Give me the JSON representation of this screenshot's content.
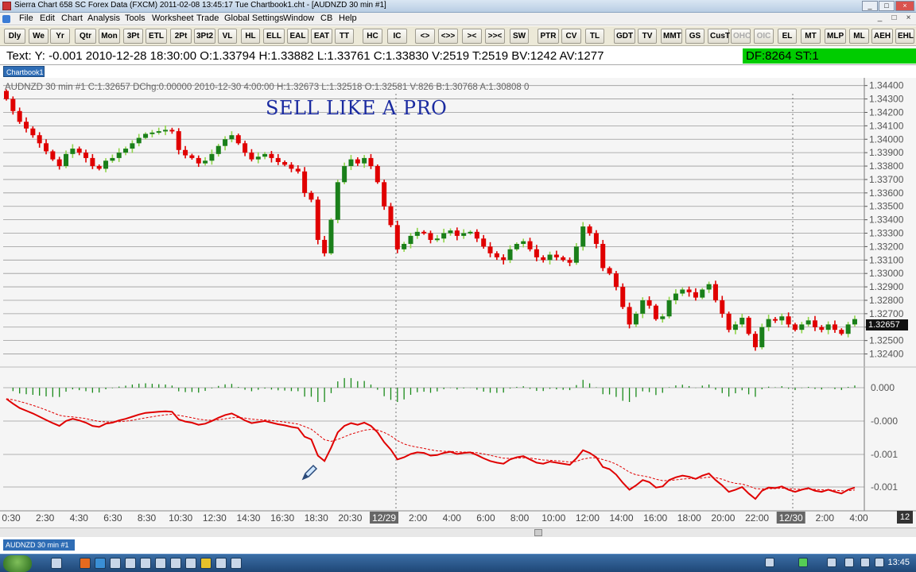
{
  "window": {
    "title": "Sierra Chart 658 SC Forex Data (FXCM) 2011-02-08  13:45:17  Tue   Chartbook1.cht - [AUDNZD  30 min   #1]",
    "controls": [
      "_",
      "□",
      "×"
    ]
  },
  "menu": {
    "items": [
      "File",
      "Edit",
      "Chart",
      "Analysis",
      "Tools",
      "Worksheet",
      "Trade",
      "Global Settings",
      "Window",
      "CB",
      "Help"
    ],
    "mdi_controls": [
      "_",
      "□",
      "×"
    ]
  },
  "toolbar": {
    "buttons": [
      "Dly",
      "We",
      "Yr",
      "Qtr",
      "Mon",
      "3Pt",
      "ETL",
      "2Pt",
      "3Pt2",
      "VL",
      "HL",
      "ELL",
      "EAL",
      "EAT",
      "TT",
      "HC",
      "IC",
      "<>",
      "<>>",
      "><",
      ">>< ",
      "SW",
      "PTR",
      "CV",
      "TL",
      "GDT",
      "TV",
      "MMT",
      "GS",
      "CusT",
      "OHC",
      "OIC",
      "EL",
      "MT",
      "MLP",
      "ML",
      "AEH",
      "EHL"
    ],
    "disabled": [
      "OHC",
      "OIC"
    ]
  },
  "status": {
    "text_line": "Text: Y: -0.001  2010-12-28   18:30:00  O:1.33794  H:1.33882  L:1.33761  C:1.33830  V:2519  T:2519  BV:1242  AV:1277",
    "df_line": "DF:8264  ST:1"
  },
  "chartbook_tab": "Chartbook1",
  "chart": {
    "header": "AUDNZD  30 min   #1 C:1.32657 DChg:0.00000 2010-12-30 4:00:00 H:1.32673 L:1.32518 O:1.32581 V:826 B:1.30768 A:1.30808 0",
    "annotation": "SELL LIKE A PRO",
    "current_price": "1.32657",
    "price_axis": [
      "1.34400",
      "1.34300",
      "1.34200",
      "1.34100",
      "1.34000",
      "1.33900",
      "1.33800",
      "1.33700",
      "1.33600",
      "1.33500",
      "1.33400",
      "1.33300",
      "1.33200",
      "1.33100",
      "1.33000",
      "1.32900",
      "1.32800",
      "1.32700",
      "1.32600",
      "1.32500",
      "1.32400"
    ],
    "indicator_axis": [
      "0.000",
      "-0.000",
      "-0.001",
      "-0.001"
    ],
    "time_labels": [
      "0:30",
      "2:30",
      "4:30",
      "6:30",
      "8:30",
      "10:30",
      "12:30",
      "14:30",
      "16:30",
      "18:30",
      "20:30",
      "12/29",
      "2:00",
      "4:00",
      "6:00",
      "8:00",
      "10:00",
      "12:00",
      "14:00",
      "16:00",
      "18:00",
      "20:00",
      "22:00",
      "12/30",
      "2:00",
      "4:00"
    ],
    "corner_label": "12",
    "colors": {
      "up": "#1a7f1a",
      "up_wick": "#8fd44a",
      "down": "#e00000",
      "macd": "#000000",
      "signal": "#e00000"
    }
  },
  "bottom_tab": "AUDNZD  30 min   #1",
  "taskbar": {
    "clock": "13:45"
  },
  "chart_data": {
    "type": "candlestick",
    "symbol": "AUDNZD",
    "interval": "30 min",
    "ylim": [
      1.3235,
      1.3441
    ],
    "closes": [
      1.343,
      1.3421,
      1.3413,
      1.3408,
      1.3403,
      1.3397,
      1.3391,
      1.3385,
      1.338,
      1.3389,
      1.3393,
      1.339,
      1.3386,
      1.338,
      1.3378,
      1.3384,
      1.3386,
      1.339,
      1.3393,
      1.3397,
      1.3401,
      1.3404,
      1.3405,
      1.3406,
      1.3407,
      1.3406,
      1.3392,
      1.3388,
      1.3386,
      1.3382,
      1.3384,
      1.3389,
      1.3395,
      1.34,
      1.3403,
      1.3397,
      1.339,
      1.3385,
      1.3387,
      1.3389,
      1.3386,
      1.3383,
      1.3381,
      1.3378,
      1.3376,
      1.336,
      1.3355,
      1.3325,
      1.3315,
      1.334,
      1.3368,
      1.338,
      1.3385,
      1.3382,
      1.3386,
      1.338,
      1.3368,
      1.335,
      1.3336,
      1.3318,
      1.3322,
      1.3328,
      1.3331,
      1.333,
      1.3325,
      1.3326,
      1.333,
      1.3332,
      1.3328,
      1.333,
      1.3331,
      1.3326,
      1.332,
      1.3315,
      1.3312,
      1.331,
      1.3318,
      1.3322,
      1.3324,
      1.3318,
      1.3312,
      1.331,
      1.3314,
      1.3312,
      1.331,
      1.3308,
      1.332,
      1.3335,
      1.333,
      1.3322,
      1.3304,
      1.33,
      1.329,
      1.3275,
      1.3262,
      1.327,
      1.328,
      1.3276,
      1.3266,
      1.3268,
      1.328,
      1.3285,
      1.3288,
      1.3286,
      1.3282,
      1.3288,
      1.3292,
      1.328,
      1.327,
      1.3258,
      1.3262,
      1.3267,
      1.3255,
      1.3245,
      1.326,
      1.3266,
      1.3265,
      1.3268,
      1.3262,
      1.3258,
      1.3262,
      1.3265,
      1.326,
      1.3258,
      1.3262,
      1.3258,
      1.3255,
      1.3262,
      1.3266
    ]
  }
}
